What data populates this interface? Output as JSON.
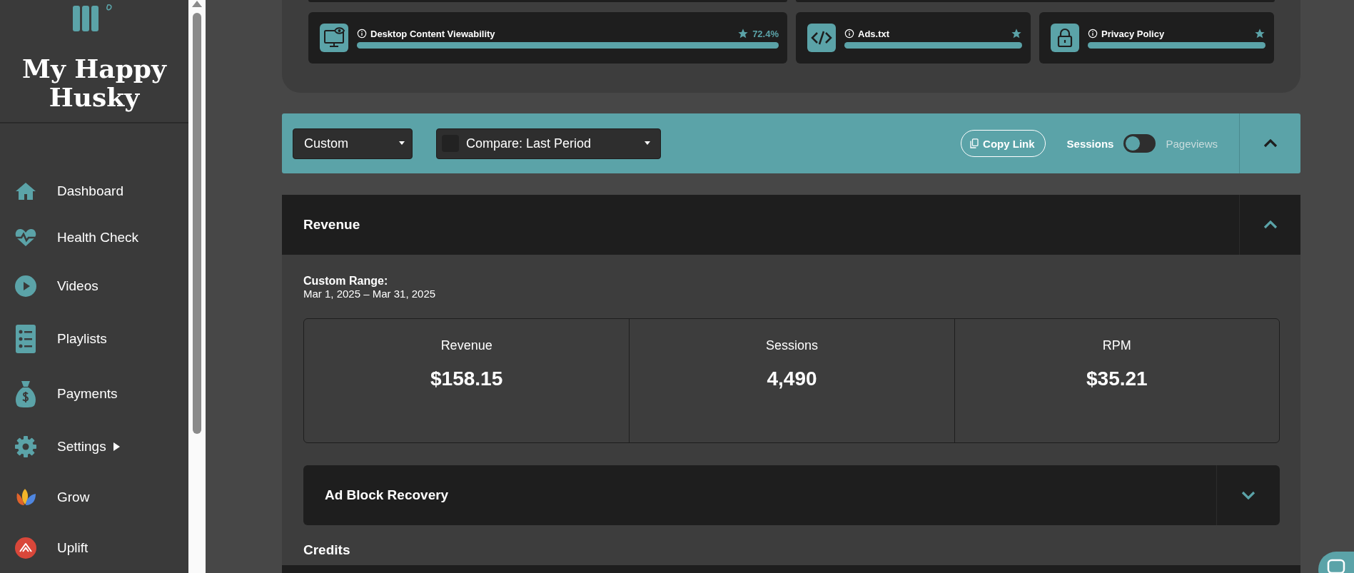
{
  "sidebar": {
    "brand": "My Happy Husky",
    "items": [
      {
        "kind": "home",
        "label": "Dashboard",
        "submenu": false
      },
      {
        "kind": "health",
        "label": "Health Check",
        "submenu": false
      },
      {
        "kind": "video",
        "label": "Videos",
        "submenu": false
      },
      {
        "kind": "list",
        "label": "Playlists",
        "submenu": false
      },
      {
        "kind": "payment",
        "label": "Payments",
        "submenu": false
      },
      {
        "kind": "settings",
        "label": "Settings",
        "submenu": true
      },
      {
        "kind": "grow",
        "label": "Grow",
        "submenu": false
      },
      {
        "kind": "uplift",
        "label": "Uplift",
        "submenu": false
      }
    ]
  },
  "health_cards": [
    {
      "kind": "viewability",
      "label": "Desktop Content Viewability",
      "score": "72.4%",
      "level": 1
    },
    {
      "kind": "code",
      "label": "Ads.txt",
      "level": 1
    },
    {
      "kind": "lock",
      "label": "Privacy Policy",
      "level": 1
    }
  ],
  "toolbar": {
    "range": "Custom",
    "compare": {
      "checked": false,
      "label": "Compare: Last Period"
    },
    "copy_link": "Copy Link",
    "toggle": {
      "left": "Sessions",
      "right": "Pageviews",
      "on": false
    },
    "expanded": true
  },
  "revenue": {
    "title": "Revenue",
    "expanded": true,
    "range_label": "Custom Range:",
    "range": "Mar 1, 2025 – Mar 31, 2025",
    "metrics": [
      {
        "label": "Revenue",
        "value": "$158.15"
      },
      {
        "label": "Sessions",
        "value": "4,490"
      },
      {
        "label": "RPM",
        "value": "$35.21"
      }
    ],
    "subsections": [
      {
        "title": "Ad Block Recovery",
        "expanded": false
      }
    ],
    "credits_title": "Credits"
  }
}
